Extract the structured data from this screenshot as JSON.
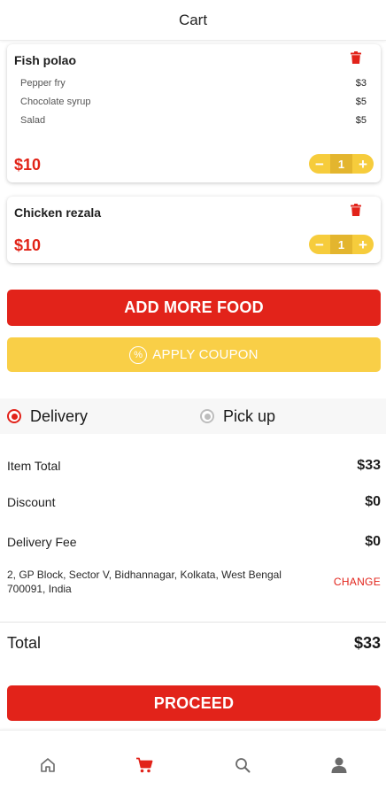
{
  "header": {
    "title": "Cart"
  },
  "cart_items": [
    {
      "name": "Fish polao",
      "addons": [
        {
          "name": "Pepper fry",
          "price": "$3"
        },
        {
          "name": "Chocolate syrup",
          "price": "$5"
        },
        {
          "name": "Salad",
          "price": "$5"
        }
      ],
      "price": "$10",
      "quantity": "1",
      "minus": "−",
      "plus": "+"
    },
    {
      "name": "Chicken rezala",
      "addons": [],
      "price": "$10",
      "quantity": "1",
      "minus": "−",
      "plus": "+"
    }
  ],
  "actions": {
    "add_more": "ADD MORE FOOD",
    "apply_coupon": "APPLY COUPON",
    "coupon_symbol": "%"
  },
  "fulfillment": {
    "delivery": "Delivery",
    "pickup": "Pick up",
    "selected": "delivery"
  },
  "summary": {
    "item_total_label": "Item Total",
    "item_total": "$33",
    "discount_label": "Discount",
    "discount": "$0",
    "delivery_fee_label": "Delivery Fee",
    "delivery_fee": "$0",
    "address": "2, GP Block, Sector V, Bidhannagar, Kolkata, West Bengal 700091, India",
    "change_label": "CHANGE",
    "total_label": "Total",
    "total": "$33"
  },
  "proceed_label": "PROCEED",
  "tabbar": {
    "icons": [
      "home-icon",
      "cart-icon",
      "search-icon",
      "profile-icon"
    ],
    "active": "cart-icon"
  },
  "colors": {
    "accent_red": "#e2231a",
    "accent_yellow": "#f9cf47",
    "stepper_yellow": "#f6cc3c",
    "inactive_icon": "#6b6b6b"
  }
}
